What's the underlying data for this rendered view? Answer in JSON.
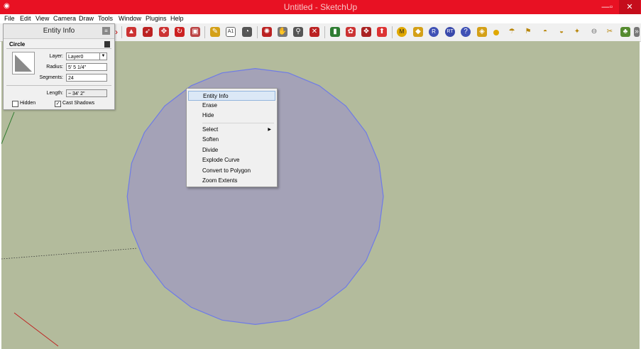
{
  "window": {
    "title": "Untitled - SketchUp",
    "min_glyph": "—",
    "max_glyph": "▫",
    "close_glyph": "✕"
  },
  "menubar": [
    "File",
    "Edit",
    "View",
    "Camera",
    "Draw",
    "Tools",
    "Window",
    "Plugins",
    "Help"
  ],
  "toolbar": {
    "text_tool_label": "A1",
    "tool_badges": [
      "M",
      "R",
      "RT"
    ]
  },
  "entity_info": {
    "title": "Entity Info",
    "entity_type": "Circle",
    "layer_label": "Layer:",
    "layer_value": "Layer0",
    "radius_label": "Radius:",
    "radius_value": "5' 5 1/4\"",
    "segments_label": "Segments:",
    "segments_value": "24",
    "length_label": "Length:",
    "length_value": "~ 34' 2\"",
    "hidden_label": "Hidden",
    "hidden_checked": false,
    "cast_shadows_label": "Cast Shadows",
    "cast_shadows_checked": true
  },
  "context_menu": {
    "items": [
      "Entity Info",
      "Erase",
      "Hide",
      "Select",
      "Soften",
      "Divide",
      "Explode Curve",
      "Convert to Polygon",
      "Zoom Extents"
    ],
    "highlighted": "Entity Info",
    "submenu_item": "Select"
  },
  "colors": {
    "titlebar": "#e81123",
    "viewport_bg": "#b3bb9c",
    "circle_fill": "#a4a2b7",
    "circle_edge": "#6e7be6",
    "menu_highlight": "#dbe8f6"
  }
}
